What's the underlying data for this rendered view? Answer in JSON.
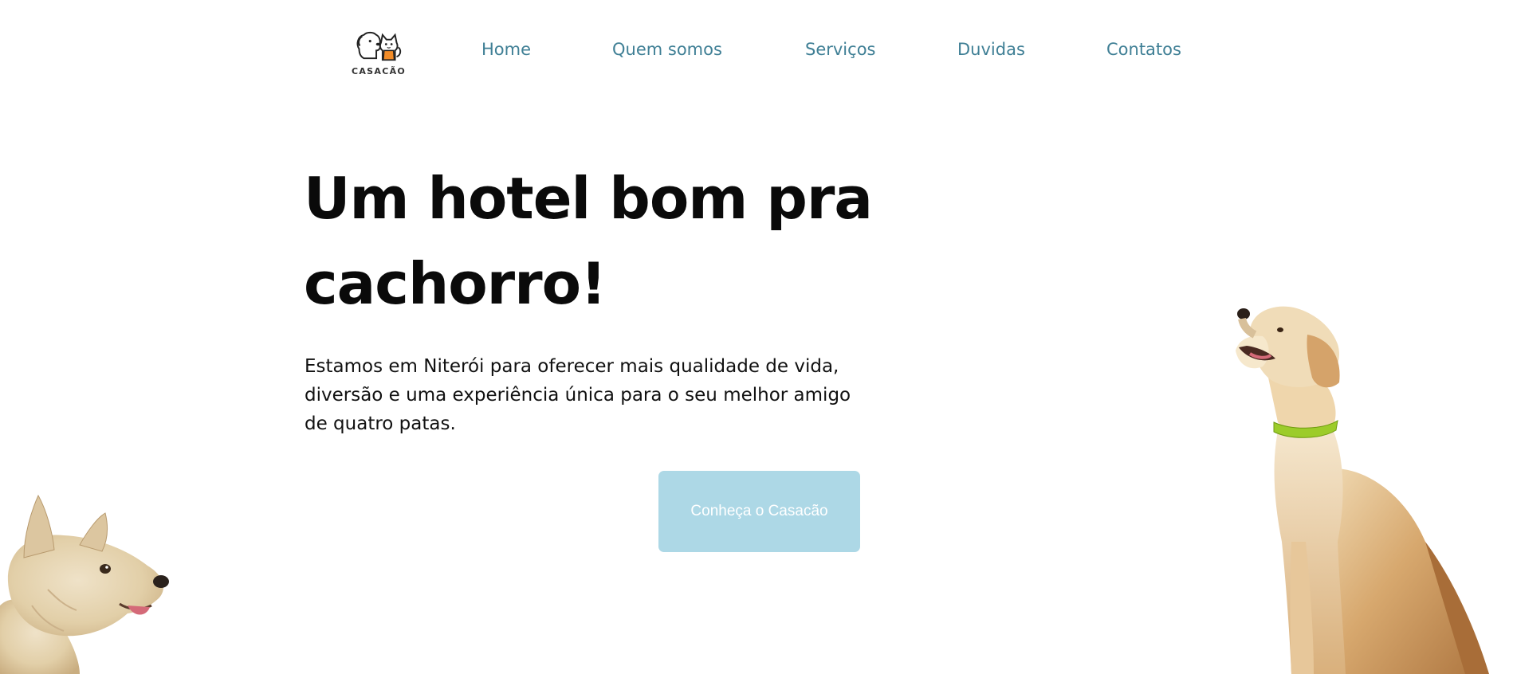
{
  "header": {
    "logo_text": "CASACÃO",
    "nav": [
      {
        "label": "Home"
      },
      {
        "label": "Quem somos"
      },
      {
        "label": "Serviços"
      },
      {
        "label": "Duvidas"
      },
      {
        "label": "Contatos"
      }
    ]
  },
  "hero": {
    "title": "Um hotel bom pra cachorro!",
    "description": "Estamos em Niterói para oferecer mais qualidade de vida, diversão e uma experiência única para o seu melhor amigo de quatro patas.",
    "cta_label": "Conheça o Casacão"
  },
  "images": {
    "logo_icon": "dog-and-cat-icon",
    "left_image": "terrier-dog-photo",
    "right_image": "golden-retriever-photo"
  },
  "colors": {
    "nav_link": "#3f7f95",
    "button_bg": "#add8e6",
    "button_text": "#ffffff",
    "title": "#0a0a0a",
    "cat_accent": "#f28c28"
  }
}
